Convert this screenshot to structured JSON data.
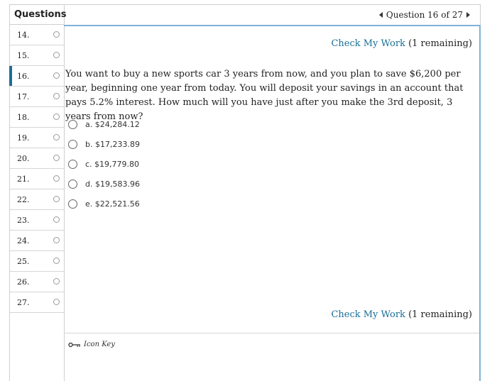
{
  "sidebar": {
    "title": "Questions",
    "items": [
      {
        "label": "14."
      },
      {
        "label": "15."
      },
      {
        "label": "16."
      },
      {
        "label": "17."
      },
      {
        "label": "18."
      },
      {
        "label": "19."
      },
      {
        "label": "20."
      },
      {
        "label": "21."
      },
      {
        "label": "22."
      },
      {
        "label": "23."
      },
      {
        "label": "24."
      },
      {
        "label": "25."
      },
      {
        "label": "26."
      },
      {
        "label": "27."
      }
    ],
    "active_index": 2
  },
  "nav": {
    "label": "Question 16 of 27"
  },
  "check_my_work": {
    "link": "Check My Work",
    "remaining": "(1 remaining)"
  },
  "question": {
    "text": "You want to buy a new sports car 3 years from now, and you plan to save $6,200 per year, beginning one year from today. You will deposit your savings in an account that pays 5.2% interest. How much will you have just after you make the 3rd deposit, 3 years from now?",
    "options": [
      {
        "label": "a. $24,284.12"
      },
      {
        "label": "b. $17,233.89"
      },
      {
        "label": "c. $19,779.80"
      },
      {
        "label": "d. $19,583.96"
      },
      {
        "label": "e. $22,521.56"
      }
    ]
  },
  "icon_key": {
    "label": "Icon Key",
    "icon": "key-icon"
  },
  "colors": {
    "accent": "#1a6f97",
    "content_border": "#7fb3d8"
  }
}
